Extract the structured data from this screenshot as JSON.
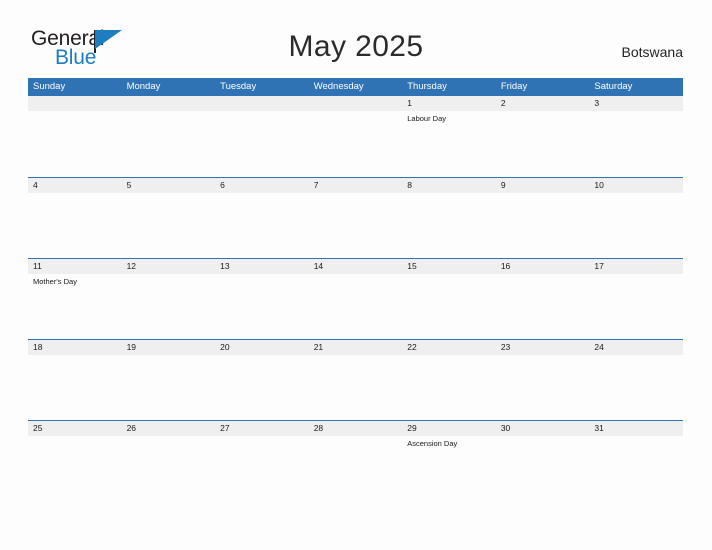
{
  "brand": {
    "name_part1": "General",
    "name_part2": "Blue",
    "flag_icon": "flag-triangle-icon",
    "accent_color": "#1d7dc0"
  },
  "header": {
    "title": "May 2025",
    "locale": "Botswana"
  },
  "calendar": {
    "header_bg_color": "#3073b4",
    "date_strip_color": "#efefef",
    "weekdays": [
      "Sunday",
      "Monday",
      "Tuesday",
      "Wednesday",
      "Thursday",
      "Friday",
      "Saturday"
    ],
    "weeks": [
      [
        {
          "date": "",
          "event": ""
        },
        {
          "date": "",
          "event": ""
        },
        {
          "date": "",
          "event": ""
        },
        {
          "date": "",
          "event": ""
        },
        {
          "date": "1",
          "event": "Labour Day"
        },
        {
          "date": "2",
          "event": ""
        },
        {
          "date": "3",
          "event": ""
        }
      ],
      [
        {
          "date": "4",
          "event": ""
        },
        {
          "date": "5",
          "event": ""
        },
        {
          "date": "6",
          "event": ""
        },
        {
          "date": "7",
          "event": ""
        },
        {
          "date": "8",
          "event": ""
        },
        {
          "date": "9",
          "event": ""
        },
        {
          "date": "10",
          "event": ""
        }
      ],
      [
        {
          "date": "11",
          "event": "Mother's Day"
        },
        {
          "date": "12",
          "event": ""
        },
        {
          "date": "13",
          "event": ""
        },
        {
          "date": "14",
          "event": ""
        },
        {
          "date": "15",
          "event": ""
        },
        {
          "date": "16",
          "event": ""
        },
        {
          "date": "17",
          "event": ""
        }
      ],
      [
        {
          "date": "18",
          "event": ""
        },
        {
          "date": "19",
          "event": ""
        },
        {
          "date": "20",
          "event": ""
        },
        {
          "date": "21",
          "event": ""
        },
        {
          "date": "22",
          "event": ""
        },
        {
          "date": "23",
          "event": ""
        },
        {
          "date": "24",
          "event": ""
        }
      ],
      [
        {
          "date": "25",
          "event": ""
        },
        {
          "date": "26",
          "event": ""
        },
        {
          "date": "27",
          "event": ""
        },
        {
          "date": "28",
          "event": ""
        },
        {
          "date": "29",
          "event": "Ascension Day"
        },
        {
          "date": "30",
          "event": ""
        },
        {
          "date": "31",
          "event": ""
        }
      ]
    ]
  }
}
